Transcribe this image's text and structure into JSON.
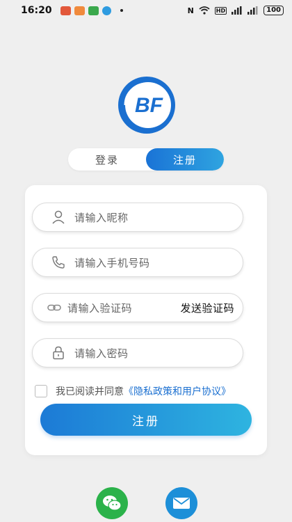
{
  "status_bar": {
    "time": "16:20",
    "indicators": "N",
    "signal_label": "HD",
    "network": "4G",
    "battery": "100"
  },
  "logo": {
    "text": "BF",
    "color": "#1a6fd0"
  },
  "tabs": [
    {
      "label": "登录",
      "active": false
    },
    {
      "label": "注册",
      "active": true
    }
  ],
  "form": {
    "nickname": {
      "placeholder": "请输入昵称",
      "icon": "user-icon"
    },
    "phone": {
      "placeholder": "请输入手机号码",
      "icon": "phone-icon"
    },
    "code": {
      "placeholder": "请输入验证码",
      "icon": "link-icon",
      "send_label": "发送验证码"
    },
    "password": {
      "placeholder": "请输入密码",
      "icon": "lock-icon"
    },
    "agree_text": "我已阅读并同意",
    "agree_link": "《隐私政策和用户协议》",
    "submit_label": "注册"
  },
  "social": [
    {
      "name": "wechat-icon",
      "color": "#2bb24a"
    },
    {
      "name": "mail-icon",
      "color": "#1d8fd8"
    }
  ],
  "colors": {
    "accent": "#1a73d6",
    "accent_light": "#2fa4e0",
    "background": "#efefef"
  }
}
